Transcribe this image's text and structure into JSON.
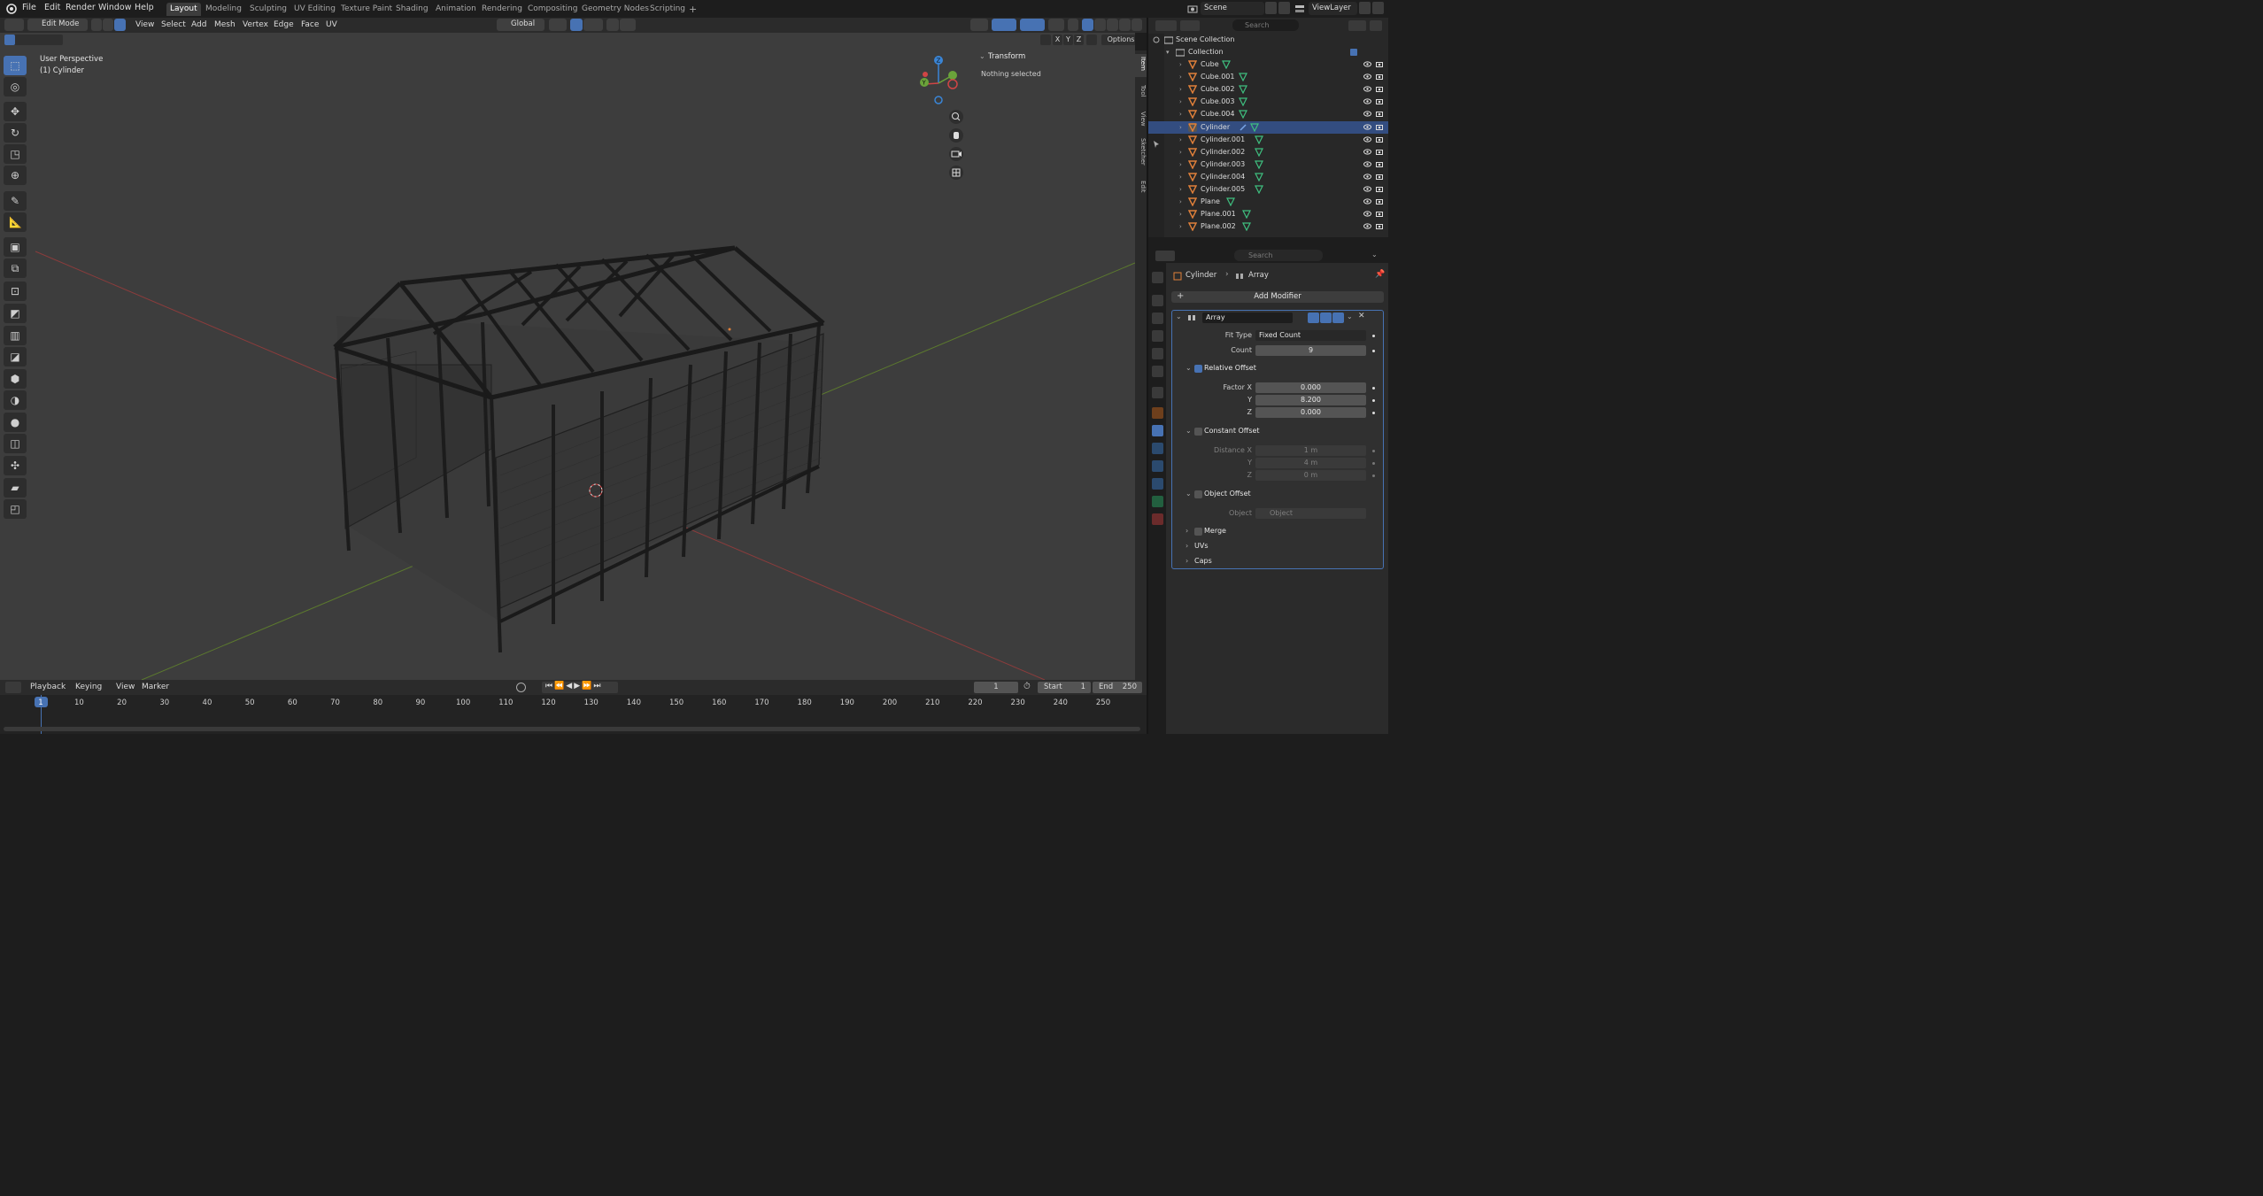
{
  "topbar": {
    "menus": [
      "File",
      "Edit",
      "Render",
      "Window",
      "Help"
    ],
    "workspaces": [
      "Layout",
      "Modeling",
      "Sculpting",
      "UV Editing",
      "Texture Paint",
      "Shading",
      "Animation",
      "Rendering",
      "Compositing",
      "Geometry Nodes",
      "Scripting"
    ],
    "active_workspace": "Layout",
    "add_tab": "+",
    "scene": "Scene",
    "view_layer": "ViewLayer"
  },
  "header3d": {
    "mode": "Edit Mode",
    "menus": [
      "View",
      "Select",
      "Add",
      "Mesh",
      "Vertex",
      "Edge",
      "Face",
      "UV"
    ],
    "transform_orientation": "Global",
    "mirror_axes": [
      "X",
      "Y",
      "Z"
    ],
    "options": "Options"
  },
  "viewport": {
    "perspective": "User Perspective",
    "object": "(1) Cylinder",
    "gizmo": {
      "z": "Z",
      "y": "Y"
    }
  },
  "npanel": {
    "section": "Transform",
    "status": "Nothing selected",
    "tabs": [
      "Item",
      "Tool",
      "View",
      "Sketcher",
      "Edit"
    ]
  },
  "outliner": {
    "search_placeholder": "Search",
    "root": "Scene Collection",
    "collection": "Collection",
    "objects": [
      "Cube",
      "Cube.001",
      "Cube.002",
      "Cube.003",
      "Cube.004",
      "Cylinder",
      "Cylinder.001",
      "Cylinder.002",
      "Cylinder.003",
      "Cylinder.004",
      "Cylinder.005",
      "Plane",
      "Plane.001",
      "Plane.002"
    ]
  },
  "properties": {
    "search_placeholder": "Search",
    "breadcrumb_object": "Cylinder",
    "breadcrumb_modifier": "Array",
    "add_modifier": "Add Modifier",
    "modifier_name": "Array",
    "fit_type_label": "Fit Type",
    "fit_type": "Fixed Count",
    "count_label": "Count",
    "count": "9",
    "relative_offset": {
      "label": "Relative Offset",
      "enabled": true,
      "factor_x_label": "Factor X",
      "y_label": "Y",
      "z_label": "Z",
      "x": "0.000",
      "y": "8.200",
      "z": "0.000"
    },
    "constant_offset": {
      "label": "Constant Offset",
      "enabled": false,
      "distance_x_label": "Distance X",
      "y_label": "Y",
      "z_label": "Z",
      "x": "1 m",
      "y": "4 m",
      "z": "0 m"
    },
    "object_offset": {
      "label": "Object Offset",
      "enabled": false,
      "object_label": "Object",
      "object_placeholder": "Object"
    },
    "merge": "Merge",
    "uvs": "UVs",
    "caps": "Caps"
  },
  "timeline": {
    "menus": [
      "Playback",
      "Keying",
      "View",
      "Marker"
    ],
    "current_frame": "1",
    "start_label": "Start",
    "start": "1",
    "end_label": "End",
    "end": "250",
    "ticks": [
      "1",
      "10",
      "20",
      "30",
      "40",
      "50",
      "60",
      "70",
      "80",
      "90",
      "100",
      "110",
      "120",
      "130",
      "140",
      "150",
      "160",
      "170",
      "180",
      "190",
      "200",
      "210",
      "220",
      "230",
      "240",
      "250"
    ]
  },
  "colors": {
    "accent": "#4772b3",
    "object_orange": "#e0803a",
    "mesh_green": "#3fbf7f"
  }
}
